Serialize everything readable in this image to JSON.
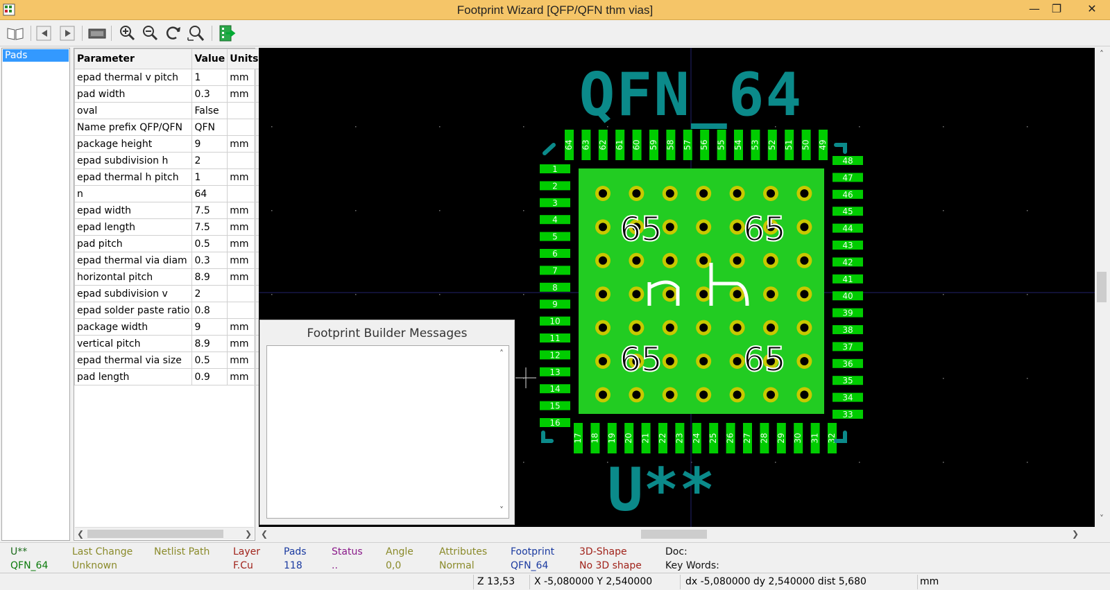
{
  "window": {
    "title": "Footprint Wizard [QFP/QFN  thm vias]",
    "minimize_glyph": "—",
    "maximize_glyph": "❐",
    "close_glyph": "✕"
  },
  "toolbar": {
    "icons": [
      "book-icon",
      "back-arrow-icon",
      "forward-arrow-icon",
      "display-options-icon",
      "zoom-in-icon",
      "zoom-out-icon",
      "redraw-icon",
      "zoom-fit-icon",
      "export-footprint-icon"
    ]
  },
  "pages": [
    {
      "label": "Pads"
    }
  ],
  "grid": {
    "headers": {
      "parameter": "Parameter",
      "value": "Value",
      "units": "Units"
    },
    "rows": [
      {
        "parameter": "epad thermal v pitch",
        "value": "1",
        "units": "mm"
      },
      {
        "parameter": "pad width",
        "value": "0.3",
        "units": "mm"
      },
      {
        "parameter": "oval",
        "value": "False",
        "units": ""
      },
      {
        "parameter": "Name prefix QFP/QFN",
        "value": "QFN",
        "units": ""
      },
      {
        "parameter": "package height",
        "value": "9",
        "units": "mm"
      },
      {
        "parameter": "epad subdivision h",
        "value": "2",
        "units": ""
      },
      {
        "parameter": "epad thermal h pitch",
        "value": "1",
        "units": "mm"
      },
      {
        "parameter": "n",
        "value": "64",
        "units": ""
      },
      {
        "parameter": "epad width",
        "value": "7.5",
        "units": "mm"
      },
      {
        "parameter": "epad length",
        "value": "7.5",
        "units": "mm"
      },
      {
        "parameter": "pad pitch",
        "value": "0.5",
        "units": "mm"
      },
      {
        "parameter": "epad thermal via diam",
        "value": "0.3",
        "units": "mm"
      },
      {
        "parameter": "horizontal pitch",
        "value": "8.9",
        "units": "mm"
      },
      {
        "parameter": "epad subdivision v",
        "value": "2",
        "units": ""
      },
      {
        "parameter": "epad solder paste ratio",
        "value": "0.8",
        "units": ""
      },
      {
        "parameter": "package width",
        "value": "9",
        "units": "mm"
      },
      {
        "parameter": "vertical pitch",
        "value": "8.9",
        "units": "mm"
      },
      {
        "parameter": "epad thermal via size",
        "value": "0.5",
        "units": "mm"
      },
      {
        "parameter": "pad length",
        "value": "0.9",
        "units": "mm"
      }
    ]
  },
  "footprint": {
    "value_text": "QFN_64",
    "reference_text": "U**",
    "epad_number": "65",
    "pads_per_side": 16,
    "via_grid": 7,
    "colors": {
      "background": "#000000",
      "text": "#0b8a8a",
      "pad": "#00cc00",
      "epad": "#22cc22",
      "via_ring": "#c8c800",
      "via_hole": "#000000",
      "outline": "#0b8a8a"
    }
  },
  "messages": {
    "title": "Footprint Builder Messages"
  },
  "info": {
    "ref": {
      "label": "U**",
      "value": "QFN_64"
    },
    "last_change": {
      "label": "Last Change",
      "value": "Unknown"
    },
    "netlist_path": {
      "label": "Netlist Path",
      "value": ""
    },
    "layer": {
      "label": "Layer",
      "value": "F.Cu"
    },
    "pads": {
      "label": "Pads",
      "value": "118"
    },
    "status": {
      "label": "Status",
      "value": ".."
    },
    "angle": {
      "label": "Angle",
      "value": "0,0"
    },
    "attributes": {
      "label": "Attributes",
      "value": "Normal"
    },
    "footprint": {
      "label": "Footprint",
      "value": "QFN_64"
    },
    "shape3d": {
      "label": "3D-Shape",
      "value": "No 3D shape"
    },
    "doc": {
      "label": "Doc:",
      "value": "Key Words:"
    }
  },
  "status": {
    "zoom": "Z 13,53",
    "xy": "X -5,080000  Y 2,540000",
    "delta": "dx -5,080000  dy 2,540000  dist 5,680",
    "units": "mm"
  }
}
